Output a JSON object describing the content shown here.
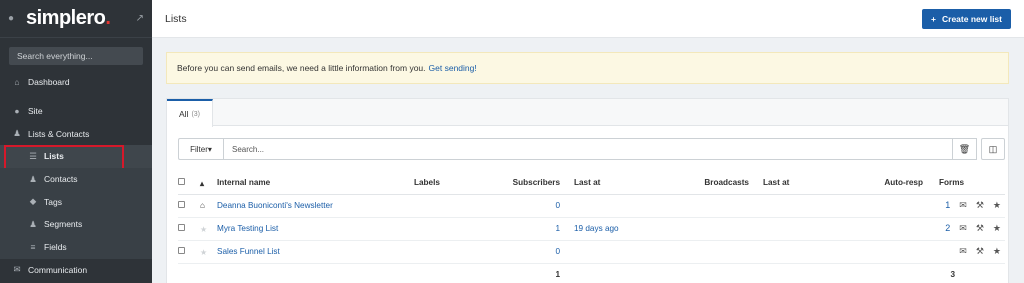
{
  "brand": {
    "name": "simplero",
    "dot": "."
  },
  "sidebar": {
    "search_placeholder": "Search everything...",
    "items": [
      {
        "label": "Dashboard",
        "icon": "home-icon"
      },
      {
        "label": "Site",
        "icon": "globe-icon"
      },
      {
        "label": "Lists & Contacts",
        "icon": "user-icon"
      }
    ],
    "subitems": [
      {
        "label": "Lists",
        "icon": "list-icon"
      },
      {
        "label": "Contacts",
        "icon": "user-icon"
      },
      {
        "label": "Tags",
        "icon": "tags-icon"
      },
      {
        "label": "Segments",
        "icon": "users-icon"
      },
      {
        "label": "Fields",
        "icon": "fields-icon"
      }
    ],
    "bottom": {
      "label": "Communication",
      "icon": "mail-icon"
    }
  },
  "header": {
    "title": "Lists",
    "create_button": "Create new list"
  },
  "notice": {
    "text": "Before you can send emails, we need a little information from you.",
    "link": "Get sending!"
  },
  "tabs": [
    {
      "label": "All",
      "count": "(3)"
    }
  ],
  "toolbar": {
    "filter_label": "Filter",
    "search_placeholder": "Search..."
  },
  "table": {
    "headers": {
      "internal_name": "Internal name",
      "labels": "Labels",
      "subscribers": "Subscribers",
      "last_at_1": "Last at",
      "broadcasts": "Broadcasts",
      "last_at_2": "Last at",
      "auto_resp": "Auto-resp",
      "forms": "Forms"
    },
    "rows": [
      {
        "name": "Deanna Buoniconti's Newsletter",
        "subscribers": "0",
        "last_at": "",
        "forms": "1",
        "home": true
      },
      {
        "name": "Myra Testing List",
        "subscribers": "1",
        "last_at": "19 days ago",
        "forms": "2",
        "home": false
      },
      {
        "name": "Sales Funnel List",
        "subscribers": "0",
        "last_at": "",
        "forms": "",
        "home": false
      }
    ],
    "totals": {
      "subscribers": "1",
      "forms": "3"
    }
  },
  "colors": {
    "sidebar_bg": "#2e3338",
    "accent": "#1b5ea8",
    "highlight_box": "#d6182a",
    "notice_bg": "#fcf8e3"
  }
}
